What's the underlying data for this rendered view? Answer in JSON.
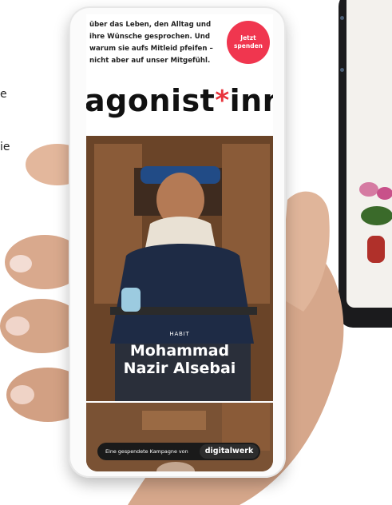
{
  "background_fragments": {
    "left_top": "e",
    "left_mid": "ie"
  },
  "phone": {
    "intro_text": "über das Leben, den Alltag und ihre Wünsche gesprochen. Und warum sie aufs Mitleid pfeifen – nicht aber auf unser Mitgefühl.",
    "donate_button": "Jetzt spenden",
    "brand_left": "agonist",
    "brand_asterisk": "*",
    "brand_right": "innen",
    "hero_label": "HABIT",
    "hero_name_line1": "Mohammad",
    "hero_name_line2": "Nazir Alsebai",
    "sponsor_text": "Eine gespendete Kampagne von",
    "sponsor_logo": "digitalwerk"
  },
  "colors": {
    "donate": "#f0364f",
    "asterisk": "#e8343c",
    "hero_bg": "#6d4a2f",
    "pill_bg": "#1a1a1a"
  }
}
